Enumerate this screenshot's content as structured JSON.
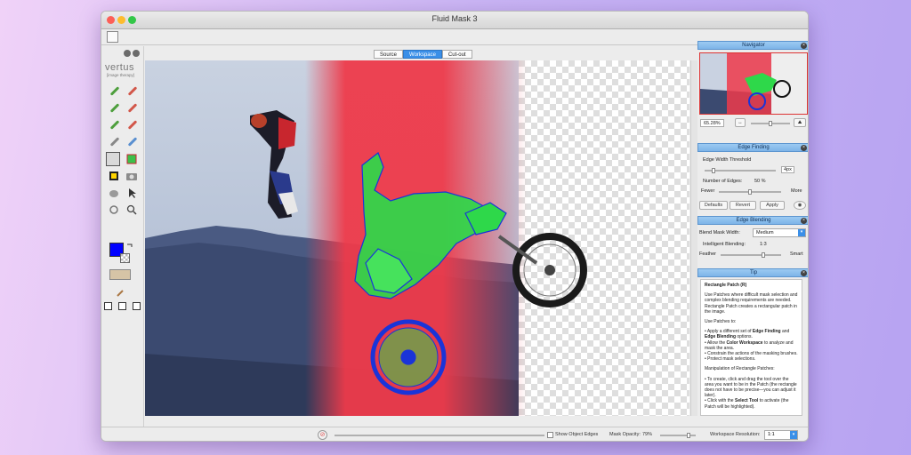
{
  "window": {
    "title": "Fluid Mask 3"
  },
  "brand": {
    "name": "vertus",
    "tagline": "[image therapy]"
  },
  "tabs": [
    "Source",
    "Workspace",
    "Cut-out"
  ],
  "navigator": {
    "title": "Navigator",
    "zoom": "65.28%"
  },
  "edge_finding": {
    "title": "Edge Finding",
    "threshold_label": "Edge Width Threshold",
    "threshold_value": "4px",
    "edges_label": "Number of Edges:",
    "edges_value": "50 %",
    "fewer_label": "Fewer",
    "more_label": "More",
    "defaults_label": "Defaults",
    "revert_label": "Revert",
    "apply_label": "Apply"
  },
  "edge_blending": {
    "title": "Edge Blending",
    "mask_width_label": "Blend Mask Width:",
    "mask_width_value": "Medium",
    "intelligent_label": "Intelligent Blending:",
    "intelligent_value": "1:3",
    "feather_label": "Feather",
    "smart_label": "Smart"
  },
  "tip": {
    "title": "Tip",
    "heading": "Rectangle Patch (R)",
    "p1": "Use Patches where difficult mask selection and complex blending requirements are needed. Rectangle Patch creates a rectangular patch in the image.",
    "p2": "Use Patches to:",
    "b1a": "• Apply a different set of ",
    "b1b": "Edge Finding",
    "b1c": " and ",
    "b1d": "Edge Blending",
    "b1e": " options.",
    "b2a": "• Allow the ",
    "b2b": "Color Workspace",
    "b2c": " to analyze and mask the area.",
    "b3": "• Constrain the actions of the masking brushes.",
    "b4": "• Protect mask selections.",
    "p3": "Manipulation of Rectangle Patches:",
    "b5": "• To create, click and drag the tool over the area you want to be in the Patch (the rectangle does not have to be precise—you can adjust it later).",
    "b6a": "• Click with the ",
    "b6b": "Select Tool",
    "b6c": " to activate (the Patch will be highlighted)."
  },
  "bottom": {
    "show_edges_label": "Show Object Edges",
    "mask_opacity_label": "Mask Opacity:",
    "mask_opacity_value": "79%",
    "workspace_resolution_label": "Workspace Resolution:",
    "workspace_resolution_value": "1:1"
  },
  "colors": {
    "mask_red": "#ee3a4a",
    "mask_green": "#2ed84a",
    "edge_blue": "#1a34d8",
    "foreground": "#0000ff"
  }
}
